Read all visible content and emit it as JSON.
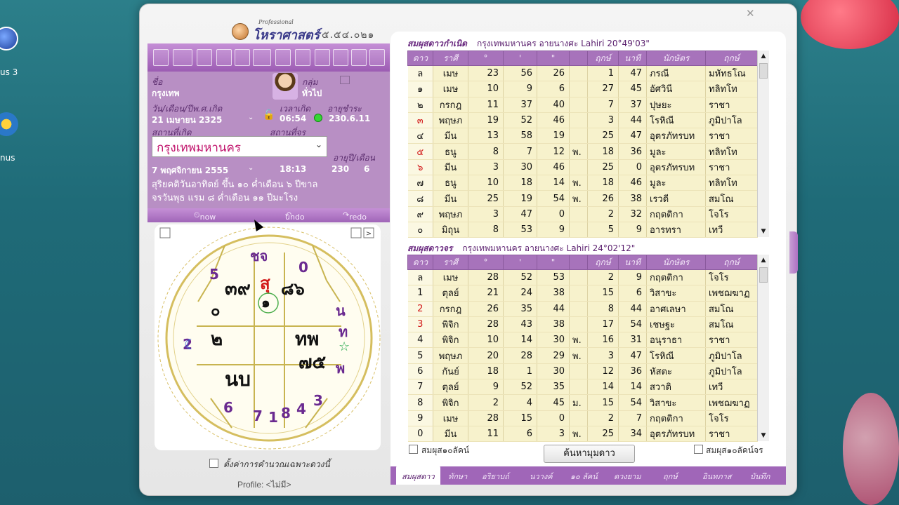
{
  "desktop": {
    "icon1_label": "us 3",
    "icon2_label": "nus"
  },
  "app": {
    "title_small": "Professional",
    "title_name": "โหราศาสตร์",
    "version": "๕.๕๔.๐๒๑"
  },
  "info": {
    "name_label": "ชื่อ",
    "name_value": "กรุงเทพ",
    "group_label": "กลุ่ม",
    "group_value": "ทั่วไป",
    "dob_label": "วัน/เดือน/ปีพ.ศ.เกิด",
    "dob_value": "21 เมษายน 2325",
    "time_label": "เวลาเกิด",
    "time_value": "06:54",
    "age_label": "อายุชำระ",
    "age_value": "230.6.11",
    "place_label": "สถานที่เกิด",
    "loc_label": "สถานที่จร",
    "location_select": "กรุงเทพมหานคร",
    "now_date_label": "วัน/เดือน/ปีจร",
    "now_time_label": "เวลาจร",
    "now_age_label": "อายุปี/เดือน",
    "now_date": "7 พฤศจิกายน 2555",
    "now_time": "18:13",
    "now_age_year": "230",
    "now_age_month": "6",
    "lunar1": "สุริยคติวันอาทิตย์ ขึ้น ๑๐ ค่ำเดือน ๖ ปีขาล",
    "lunar2": "จรวันพุธ แรม ๘ ค่ำเดือน ๑๑ ปีมะโรง"
  },
  "nav": {
    "now": "now",
    "undo": "undo",
    "redo": "redo"
  },
  "chart": {
    "center_glyphs": [
      "สุ",
      "๑"
    ],
    "cells": {
      "top_left": "๓๙",
      "top_right": "๘๖",
      "left": "๒",
      "right": "ทพ",
      "bottom_right": "๗๕",
      "bottom_left": "นบ",
      "ring_left": "๐"
    },
    "outer_marks": [
      {
        "t": "ชจ",
        "c": "#6a2a90"
      },
      {
        "t": "5",
        "c": "#6a2a90"
      },
      {
        "t": "0",
        "c": "#6a2a90"
      },
      {
        "t": "น",
        "c": "#6a2a90"
      },
      {
        "t": "ท",
        "c": "#6a2a90"
      },
      {
        "t": "พ",
        "c": "#6a2a90"
      },
      {
        "t": "6",
        "c": "#6a2a90"
      },
      {
        "t": "7",
        "c": "#6a2a90"
      },
      {
        "t": "1",
        "c": "#6a2a90"
      },
      {
        "t": "8",
        "c": "#6a2a90"
      },
      {
        "t": "4",
        "c": "#6a2a90"
      },
      {
        "t": "3",
        "c": "#6a2a90"
      },
      {
        "t": "2",
        "c": "#6a2a90"
      }
    ],
    "accent": "#c8b450"
  },
  "options": {
    "calc_only": "ตั้งค่าการคำนวณเฉพาะดวงนี้"
  },
  "profile": "Profile: <ไม่มี>",
  "natal": {
    "title": "สมผุสดาวกำเนิด",
    "subtitle": "กรุงเทพมหานคร อายนางศะ Lahiri 20°49'03\"",
    "headers": [
      "ดาว",
      "ราศี",
      "°",
      "'",
      "\"",
      "",
      "ฤกษ์",
      "นาที",
      "นักษัตร",
      "ฤกษ์"
    ],
    "rows": [
      {
        "star": "ล",
        "red": false,
        "sign": "เมษ",
        "d": "23",
        "m": "56",
        "s": "26",
        "r": "",
        "lk": "1",
        "min": "47",
        "nak": "ภรณี",
        "lk2": "มหัทธโณ"
      },
      {
        "star": "๑",
        "red": false,
        "sign": "เมษ",
        "d": "10",
        "m": "9",
        "s": "6",
        "r": "",
        "lk": "27",
        "min": "45",
        "nak": "อัศวินี",
        "lk2": "ทลิทโท"
      },
      {
        "star": "๒",
        "red": false,
        "sign": "กรกฎ",
        "d": "11",
        "m": "37",
        "s": "40",
        "r": "",
        "lk": "7",
        "min": "37",
        "nak": "ปุษยะ",
        "lk2": "ราชา"
      },
      {
        "star": "๓",
        "red": true,
        "sign": "พฤษภ",
        "d": "19",
        "m": "52",
        "s": "46",
        "r": "",
        "lk": "3",
        "min": "44",
        "nak": "โรหิณี",
        "lk2": "ภูมิปาโล"
      },
      {
        "star": "๔",
        "red": false,
        "sign": "มีน",
        "d": "13",
        "m": "58",
        "s": "19",
        "r": "",
        "lk": "25",
        "min": "47",
        "nak": "อุตรภัทรบท",
        "lk2": "ราชา"
      },
      {
        "star": "๕",
        "red": true,
        "sign": "ธนู",
        "d": "8",
        "m": "7",
        "s": "12",
        "r": "พ.",
        "lk": "18",
        "min": "36",
        "nak": "มูละ",
        "lk2": "ทลิทโท"
      },
      {
        "star": "๖",
        "red": true,
        "sign": "มีน",
        "d": "3",
        "m": "30",
        "s": "46",
        "r": "",
        "lk": "25",
        "min": "0",
        "nak": "อุตรภัทรบท",
        "lk2": "ราชา"
      },
      {
        "star": "๗",
        "red": false,
        "sign": "ธนู",
        "d": "10",
        "m": "18",
        "s": "14",
        "r": "พ.",
        "lk": "18",
        "min": "46",
        "nak": "มูละ",
        "lk2": "ทลิทโท"
      },
      {
        "star": "๘",
        "red": false,
        "sign": "มีน",
        "d": "25",
        "m": "19",
        "s": "54",
        "r": "พ.",
        "lk": "26",
        "min": "38",
        "nak": "เรวดี",
        "lk2": "สมโณ"
      },
      {
        "star": "๙",
        "red": false,
        "sign": "พฤษภ",
        "d": "3",
        "m": "47",
        "s": "0",
        "r": "",
        "lk": "2",
        "min": "32",
        "nak": "กฤตติกา",
        "lk2": "โจโร"
      },
      {
        "star": "๐",
        "red": false,
        "sign": "มิถุน",
        "d": "8",
        "m": "53",
        "s": "9",
        "r": "",
        "lk": "5",
        "min": "9",
        "nak": "อารทรา",
        "lk2": "เทวี"
      }
    ]
  },
  "transit": {
    "title": "สมผุสดาวจร",
    "subtitle": "กรุงเทพมหานคร อายนางศะ Lahiri 24°02'12\"",
    "headers": [
      "ดาว",
      "ราศี",
      "°",
      "'",
      "\"",
      "",
      "ฤกษ์",
      "นาที",
      "นักษัตร",
      "ฤกษ์"
    ],
    "rows": [
      {
        "star": "ล",
        "red": false,
        "sign": "เมษ",
        "d": "28",
        "m": "52",
        "s": "53",
        "r": "",
        "lk": "2",
        "min": "9",
        "nak": "กฤตติกา",
        "lk2": "โจโร"
      },
      {
        "star": "1",
        "red": false,
        "sign": "ตุลย์",
        "d": "21",
        "m": "24",
        "s": "38",
        "r": "",
        "lk": "15",
        "min": "6",
        "nak": "วิสาขะ",
        "lk2": "เพชฌฆาฏ"
      },
      {
        "star": "2",
        "red": true,
        "sign": "กรกฎ",
        "d": "26",
        "m": "35",
        "s": "44",
        "r": "",
        "lk": "8",
        "min": "44",
        "nak": "อาศเลษา",
        "lk2": "สมโณ"
      },
      {
        "star": "3",
        "red": true,
        "sign": "พิจิก",
        "d": "28",
        "m": "43",
        "s": "38",
        "r": "",
        "lk": "17",
        "min": "54",
        "nak": "เชษฐะ",
        "lk2": "สมโณ"
      },
      {
        "star": "4",
        "red": false,
        "sign": "พิจิก",
        "d": "10",
        "m": "14",
        "s": "30",
        "r": "พ.",
        "lk": "16",
        "min": "31",
        "nak": "อนุราธา",
        "lk2": "ราชา"
      },
      {
        "star": "5",
        "red": false,
        "sign": "พฤษภ",
        "d": "20",
        "m": "28",
        "s": "29",
        "r": "พ.",
        "lk": "3",
        "min": "47",
        "nak": "โรหิณี",
        "lk2": "ภูมิปาโล"
      },
      {
        "star": "6",
        "red": false,
        "sign": "กันย์",
        "d": "18",
        "m": "1",
        "s": "30",
        "r": "",
        "lk": "12",
        "min": "36",
        "nak": "หัสตะ",
        "lk2": "ภูมิปาโล"
      },
      {
        "star": "7",
        "red": false,
        "sign": "ตุลย์",
        "d": "9",
        "m": "52",
        "s": "35",
        "r": "",
        "lk": "14",
        "min": "14",
        "nak": "สวาติ",
        "lk2": "เทวี"
      },
      {
        "star": "8",
        "red": false,
        "sign": "พิจิก",
        "d": "2",
        "m": "4",
        "s": "45",
        "r": "ม.",
        "lk": "15",
        "min": "54",
        "nak": "วิสาขะ",
        "lk2": "เพชฌฆาฏ"
      },
      {
        "star": "9",
        "red": false,
        "sign": "เมษ",
        "d": "28",
        "m": "15",
        "s": "0",
        "r": "",
        "lk": "2",
        "min": "7",
        "nak": "กฤตติกา",
        "lk2": "โจโร"
      },
      {
        "star": "0",
        "red": false,
        "sign": "มีน",
        "d": "11",
        "m": "6",
        "s": "3",
        "r": "พ.",
        "lk": "25",
        "min": "34",
        "nak": "อุตรภัทรบท",
        "lk2": "ราชา"
      }
    ]
  },
  "bottom": {
    "chk_left": "สมผุส๑๐ลัคน์",
    "search_button": "ค้นหามุมดาว",
    "chk_right": "สมผุส๑๐ลัคน์จร"
  },
  "tabs": [
    "สมผุสดาว",
    "ทักษา",
    "อริยาบถ์",
    "นวางค์",
    "๑๐ ลัคน์",
    "ดวงยาม",
    "ฤกษ์",
    "อินทภาส",
    "บันทึก"
  ],
  "colors": {
    "purple": "#a066b8",
    "cell_yellow": "#f7f2cc",
    "red_text": "#d21a1a"
  }
}
